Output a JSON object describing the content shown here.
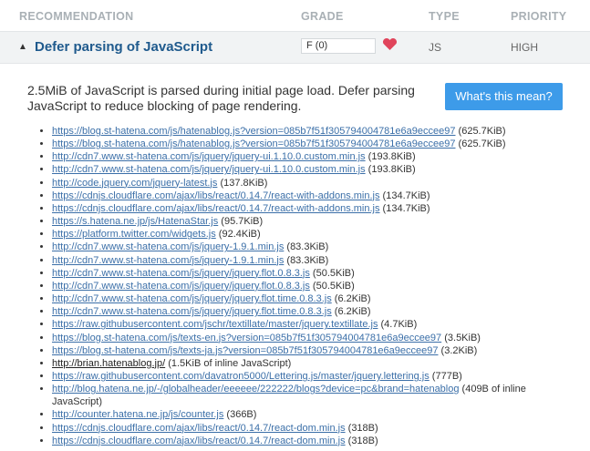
{
  "header": {
    "recommendation": "RECOMMENDATION",
    "grade": "GRADE",
    "type": "TYPE",
    "priority": "PRIORITY"
  },
  "row": {
    "toggle_glyph": "▲",
    "title": "Defer parsing of JavaScript",
    "grade_value": "F (0)",
    "heart_icon": "heart-icon",
    "type": "JS",
    "priority": "HIGH"
  },
  "details": {
    "summary": "2.5MiB of JavaScript is parsed during initial page load. Defer parsing JavaScript to reduce blocking of page rendering.",
    "button": "What's this mean?",
    "resources": [
      {
        "url": "https://blog.st-hatena.com/js/hatenablog.js?version=085b7f51f305794004781e6a9eccee97",
        "size": " (625.7KiB)"
      },
      {
        "url": "https://blog.st-hatena.com/js/hatenablog.js?version=085b7f51f305794004781e6a9eccee97",
        "size": " (625.7KiB)"
      },
      {
        "url": "http://cdn7.www.st-hatena.com/js/jquery/jquery-ui.1.10.0.custom.min.js",
        "size": " (193.8KiB)"
      },
      {
        "url": "http://cdn7.www.st-hatena.com/js/jquery/jquery-ui.1.10.0.custom.min.js",
        "size": " (193.8KiB)"
      },
      {
        "url": "http://code.jquery.com/jquery-latest.js",
        "size": " (137.8KiB)"
      },
      {
        "url": "https://cdnjs.cloudflare.com/ajax/libs/react/0.14.7/react-with-addons.min.js",
        "size": " (134.7KiB)"
      },
      {
        "url": "https://cdnjs.cloudflare.com/ajax/libs/react/0.14.7/react-with-addons.min.js",
        "size": " (134.7KiB)"
      },
      {
        "url": "https://s.hatena.ne.jp/js/HatenaStar.js",
        "size": " (95.7KiB)"
      },
      {
        "url": "https://platform.twitter.com/widgets.js",
        "size": " (92.4KiB)"
      },
      {
        "url": "http://cdn7.www.st-hatena.com/js/jquery-1.9.1.min.js",
        "size": " (83.3KiB)"
      },
      {
        "url": "http://cdn7.www.st-hatena.com/js/jquery-1.9.1.min.js",
        "size": " (83.3KiB)"
      },
      {
        "url": "http://cdn7.www.st-hatena.com/js/jquery/jquery.flot.0.8.3.js",
        "size": " (50.5KiB)"
      },
      {
        "url": "http://cdn7.www.st-hatena.com/js/jquery/jquery.flot.0.8.3.js",
        "size": " (50.5KiB)"
      },
      {
        "url": "http://cdn7.www.st-hatena.com/js/jquery/jquery.flot.time.0.8.3.js",
        "size": " (6.2KiB)"
      },
      {
        "url": "http://cdn7.www.st-hatena.com/js/jquery/jquery.flot.time.0.8.3.js",
        "size": " (6.2KiB)"
      },
      {
        "url": "https://raw.githubusercontent.com/jschr/textillate/master/jquery.textillate.js",
        "size": " (4.7KiB)"
      },
      {
        "url": "https://blog.st-hatena.com/js/texts-en.js?version=085b7f51f305794004781e6a9eccee97",
        "size": " (3.5KiB)"
      },
      {
        "url": "https://blog.st-hatena.com/js/texts-ja.js?version=085b7f51f305794004781e6a9eccee97",
        "size": " (3.2KiB)"
      },
      {
        "url": "http://brian.hatenablog.jp/",
        "size": " (1.5KiB of inline JavaScript)",
        "plain": true
      },
      {
        "url": "https://raw.githubusercontent.com/davatron5000/Lettering.js/master/jquery.lettering.js",
        "size": " (777B)"
      },
      {
        "url": "http://blog.hatena.ne.jp/-/globalheader/eeeeee/222222/blogs?device=pc&brand=hatenablog",
        "size": " (409B of inline JavaScript)"
      },
      {
        "url": "http://counter.hatena.ne.jp/js/counter.js",
        "size": " (366B)"
      },
      {
        "url": "https://cdnjs.cloudflare.com/ajax/libs/react/0.14.7/react-dom.min.js",
        "size": " (318B)"
      },
      {
        "url": "https://cdnjs.cloudflare.com/ajax/libs/react/0.14.7/react-dom.min.js",
        "size": " (318B)"
      }
    ]
  },
  "colors": {
    "link": "#3b6fa8",
    "title": "#1f5a8d",
    "button": "#3d9be9",
    "heart": "#e0445b",
    "header_text": "#a9b0b5",
    "row_bg": "#f1f3f4"
  }
}
